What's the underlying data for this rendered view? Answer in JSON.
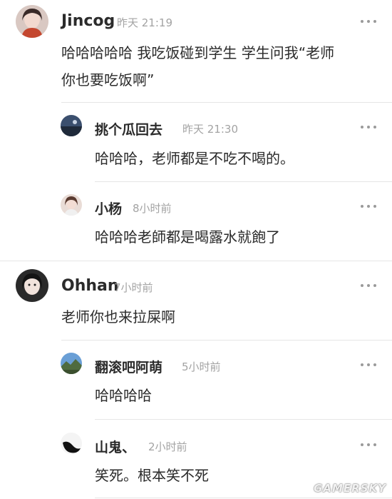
{
  "comments": [
    {
      "name": "Jincog",
      "time": "昨天 21:19",
      "text_lines": [
        "哈哈哈哈哈 我吃饭碰到学生 学生问我“老师",
        "你也要吃饭啊”"
      ],
      "avatar_icon": "portrait-avatar"
    },
    {
      "name": "挑个瓜回去",
      "time": "昨天 21:30",
      "text": "哈哈哈，老师都是不吃不喝的。",
      "avatar_icon": "landscape-avatar"
    },
    {
      "name": "小杨",
      "time": "8小时前",
      "text": "哈哈哈老師都是喝露水就飽了",
      "avatar_icon": "portrait-avatar"
    },
    {
      "name": "Ohhan",
      "time": "7小时前",
      "text": "老师你也来拉屎啊",
      "avatar_icon": "portrait-avatar"
    },
    {
      "name": "翻滚吧阿萌",
      "time": "5小时前",
      "text": "哈哈哈哈",
      "avatar_icon": "landscape-avatar"
    },
    {
      "name": "山鬼、",
      "time": "2小时前",
      "text": "笑死。根本笑不死",
      "avatar_icon": "dark-abstract-avatar"
    }
  ],
  "watermark": "GAMERSKY",
  "colors": {
    "name": "#2b2b2b",
    "time": "#a3a3a3",
    "divider": "#e6e6e6",
    "dots": "#9a9a9a"
  }
}
